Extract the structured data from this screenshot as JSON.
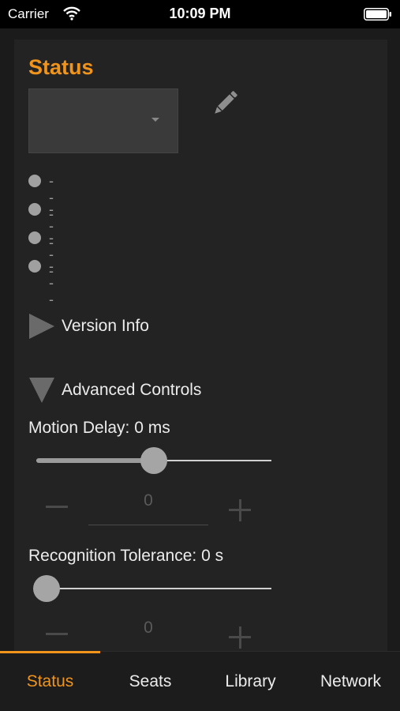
{
  "status_bar": {
    "carrier": "Carrier",
    "time": "10:09 PM"
  },
  "status_panel": {
    "title": "Status",
    "dropdown_value": "",
    "status_items": [
      "---",
      "---",
      "---",
      "---"
    ]
  },
  "sections": {
    "version_info": {
      "label": "Version Info",
      "expanded": false
    },
    "advanced_controls": {
      "label": "Advanced Controls",
      "expanded": true
    }
  },
  "motion_delay": {
    "label": "Motion Delay: 0 ms",
    "slider_fraction": 0.5,
    "stepper_value": "0"
  },
  "recognition_tolerance": {
    "label": "Recognition Tolerance: 0 s",
    "slider_fraction": 0.0,
    "stepper_value": "0"
  },
  "tabs": [
    {
      "label": "Status",
      "active": true
    },
    {
      "label": "Seats",
      "active": false
    },
    {
      "label": "Library",
      "active": false
    },
    {
      "label": "Network",
      "active": false
    }
  ],
  "colors": {
    "accent": "#f0941c",
    "panel": "#232323",
    "background": "#1b1b1b"
  },
  "icons": {
    "edit": "pencil-icon",
    "collapsed": "triangle-right-icon",
    "expanded": "triangle-down-icon"
  }
}
